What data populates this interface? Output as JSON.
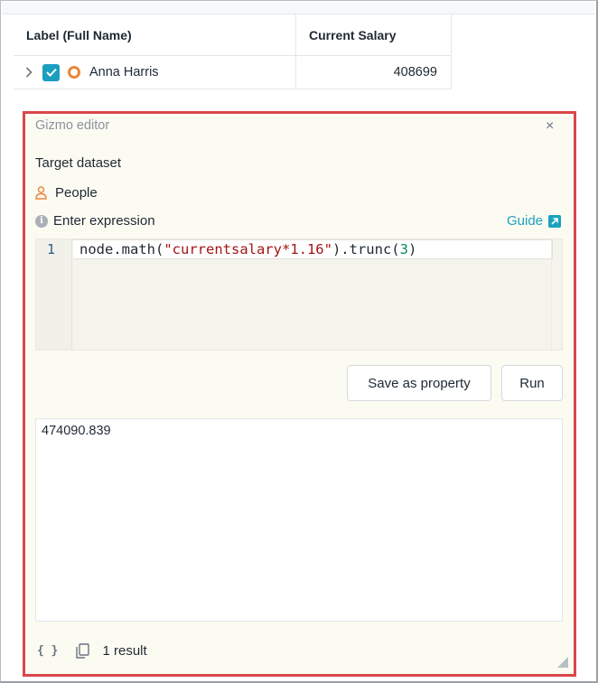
{
  "table": {
    "columns": [
      "Label (Full Name)",
      "Current Salary"
    ],
    "rows": [
      {
        "label": "Anna Harris",
        "salary": "408699",
        "checked": true
      }
    ]
  },
  "editor": {
    "title": "Gizmo editor",
    "close": "×",
    "target_label": "Target dataset",
    "dataset": "People",
    "expression_label": "Enter expression",
    "guide": "Guide",
    "line_number": "1",
    "code": {
      "prefix": "node.math(",
      "string": "\"currentsalary*1.16\"",
      "middle": ").trunc(",
      "number": "3",
      "suffix": ")"
    },
    "save_button": "Save as property",
    "run_button": "Run",
    "result": "474090.839",
    "result_count": "1 result"
  },
  "colors": {
    "accent": "#1aa3c0",
    "checkbox": "#1a9fbf",
    "node_ring": "#e8873a",
    "highlight_border": "#d9474b"
  },
  "icons": [
    "chevron-right-icon",
    "check-icon",
    "node-ring-icon",
    "close-icon",
    "person-icon",
    "info-icon",
    "external-link-icon",
    "braces-icon",
    "copy-icon",
    "resize-handle-icon"
  ]
}
